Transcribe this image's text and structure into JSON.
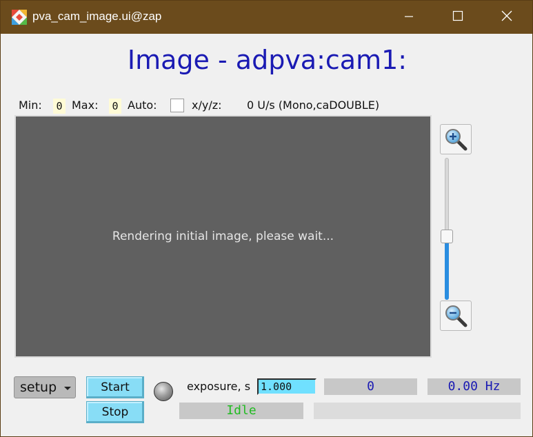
{
  "window": {
    "title": "pva_cam_image.ui@zap",
    "minimize_icon": "minimize-icon",
    "maximize_icon": "maximize-icon",
    "close_icon": "close-icon"
  },
  "heading": "Image - adpva:cam1:",
  "infobar": {
    "min_label": "Min:",
    "min_value": "0",
    "max_label": "Max:",
    "max_value": "0",
    "auto_label": "Auto:",
    "auto_checked": false,
    "xyz_label": "x/y/z:",
    "xyz_value": "0 U/s (Mono,caDOUBLE)"
  },
  "image": {
    "message": "Rendering initial image, please wait..."
  },
  "zoom": {
    "zoom_in_icon": "zoom-in-icon",
    "zoom_out_icon": "zoom-out-icon",
    "slider_level": 0.45
  },
  "controls": {
    "setup_label": "setup",
    "start_label": "Start",
    "stop_label": "Stop",
    "exposure_label": "exposure, s",
    "exposure_value": "1.000",
    "counter_value": "0",
    "rate_value": "0.00 Hz",
    "status_value": "Idle",
    "status_color": "#22bb22",
    "accent_color": "#88ddf6",
    "readout_color": "#1a1ab3"
  }
}
